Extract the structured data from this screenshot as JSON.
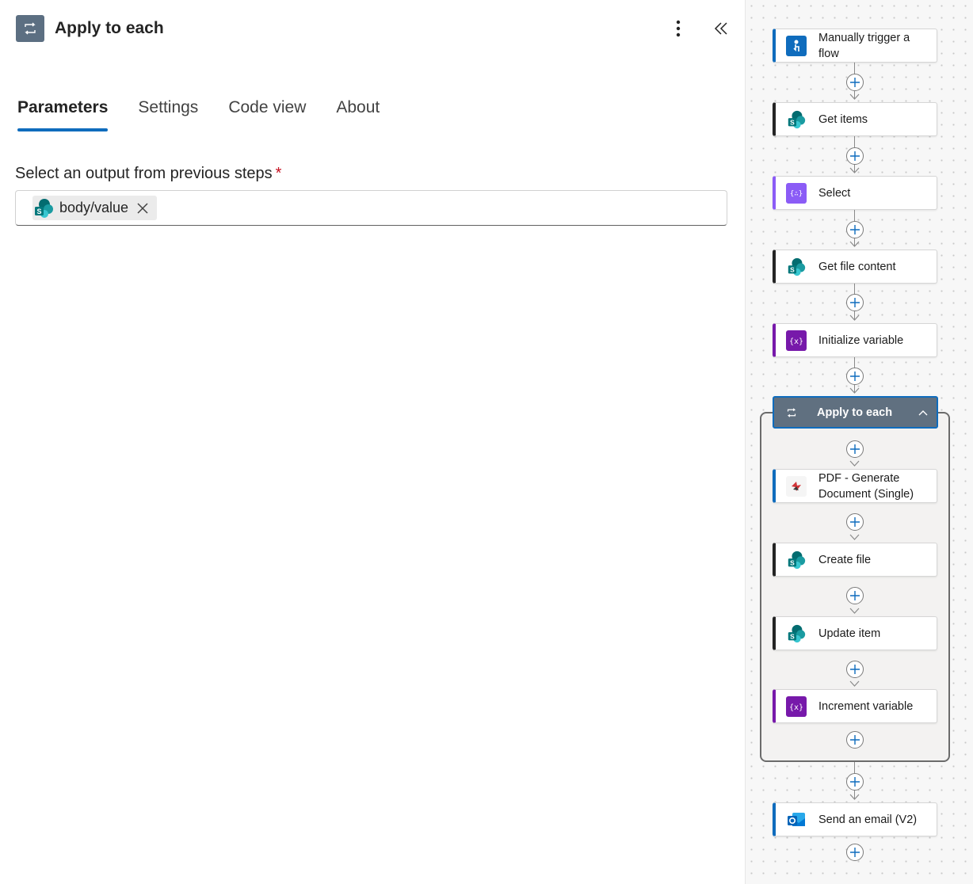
{
  "panel": {
    "title": "Apply to each",
    "header_icon": "loop-icon",
    "more_icon": "more-vertical-icon",
    "collapse_icon": "double-chevron-left-icon"
  },
  "tabs": [
    {
      "label": "Parameters",
      "active": true
    },
    {
      "label": "Settings",
      "active": false
    },
    {
      "label": "Code view",
      "active": false
    },
    {
      "label": "About",
      "active": false
    }
  ],
  "parameters": {
    "field_label": "Select an output from previous steps",
    "required_mark": "*",
    "token": {
      "icon": "sharepoint-icon",
      "label": "body/value",
      "remove_icon": "close-icon"
    }
  },
  "flow": {
    "nodes": [
      {
        "label": "Manually trigger a flow",
        "icon": "manual-trigger-icon",
        "accent": "#0f6cbd"
      },
      {
        "label": "Get items",
        "icon": "sharepoint-icon",
        "accent": "#242424"
      },
      {
        "label": "Select",
        "icon": "data-operation-icon",
        "accent": "#8b5cf6"
      },
      {
        "label": "Get file content",
        "icon": "sharepoint-icon",
        "accent": "#242424"
      },
      {
        "label": "Initialize variable",
        "icon": "variable-icon",
        "accent": "#7719aa"
      }
    ],
    "loop": {
      "label": "Apply to each",
      "icon": "loop-icon",
      "chevron_icon": "chevron-up-icon",
      "children": [
        {
          "label": "PDF - Generate Document (Single)",
          "icon": "pdf-generator-icon",
          "accent": "#0f6cbd"
        },
        {
          "label": "Create file",
          "icon": "sharepoint-icon",
          "accent": "#242424"
        },
        {
          "label": "Update item",
          "icon": "sharepoint-icon",
          "accent": "#242424"
        },
        {
          "label": "Increment variable",
          "icon": "variable-icon",
          "accent": "#7719aa"
        }
      ]
    },
    "after": [
      {
        "label": "Send an email (V2)",
        "icon": "outlook-icon",
        "accent": "#0f6cbd"
      }
    ],
    "add_icon": "add-icon"
  },
  "colors": {
    "accent": "#0f6cbd",
    "loop_header": "#607080",
    "required": "#c50f1f"
  }
}
